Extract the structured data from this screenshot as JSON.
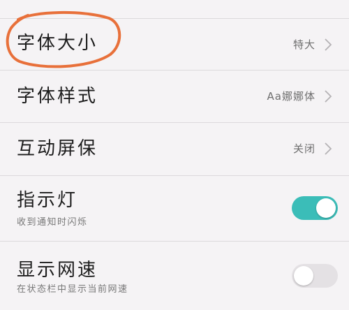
{
  "settings": {
    "items": [
      {
        "title": "字体大小",
        "value": "特大"
      },
      {
        "title": "字体样式",
        "value": "Aa娜娜体"
      },
      {
        "title": "互动屏保",
        "value": "关闭"
      },
      {
        "title": "指示灯",
        "subtitle": "收到通知时闪烁",
        "toggle_state": "on"
      },
      {
        "title": "显示网速",
        "subtitle": "在状态栏中显示当前网速",
        "toggle_state": "off"
      }
    ]
  },
  "colors": {
    "background": "#f5f3f5",
    "toggle_on": "#3bbdb8",
    "toggle_off": "#e4e1e4",
    "annotation_circle": "#e8703a"
  },
  "icons": {
    "chevron": "chevron-right-icon"
  }
}
